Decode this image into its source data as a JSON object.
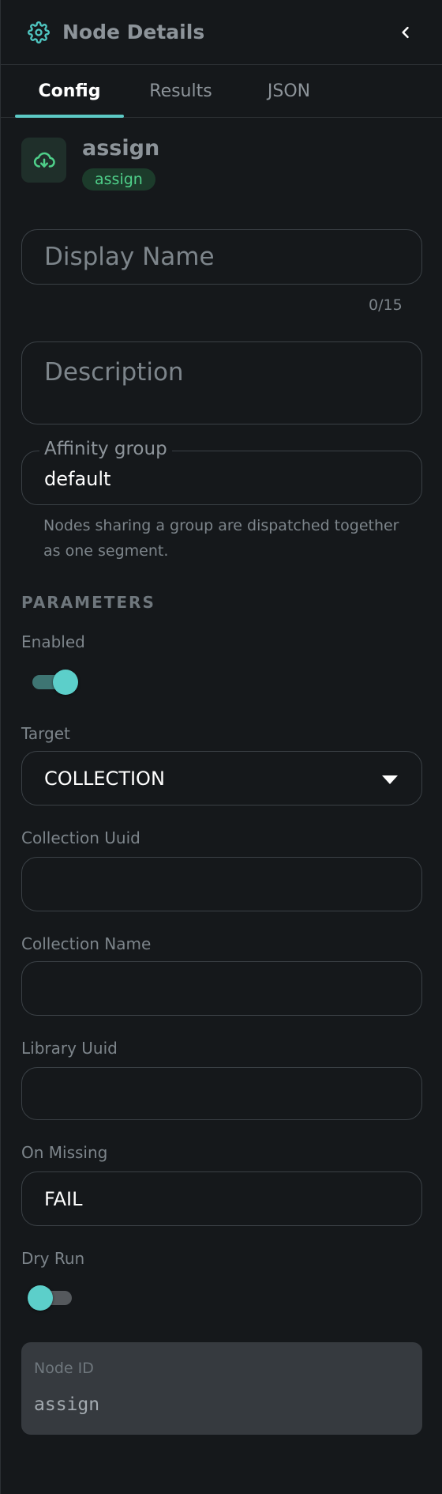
{
  "header": {
    "title": "Node Details",
    "icon": "gear-icon",
    "collapse_icon": "chevron-left-icon"
  },
  "tabs": [
    {
      "label": "Config",
      "active": true
    },
    {
      "label": "Results",
      "active": false
    },
    {
      "label": "JSON",
      "active": false
    }
  ],
  "node": {
    "name": "assign",
    "type_badge": "assign",
    "icon": "cloud-download-icon"
  },
  "display_name": {
    "placeholder": "Display Name",
    "value": "",
    "counter": "0/15"
  },
  "description": {
    "placeholder": "Description",
    "value": ""
  },
  "affinity_group": {
    "label": "Affinity group",
    "value": "default",
    "helper": "Nodes sharing a group are dispatched together as one segment."
  },
  "parameters": {
    "section_title": "PARAMETERS",
    "enabled": {
      "label": "Enabled",
      "on": true
    },
    "target": {
      "label": "Target",
      "value": "COLLECTION"
    },
    "collection_uuid": {
      "label": "Collection Uuid",
      "value": ""
    },
    "collection_name": {
      "label": "Collection Name",
      "value": ""
    },
    "library_uuid": {
      "label": "Library Uuid",
      "value": ""
    },
    "on_missing": {
      "label": "On Missing",
      "value": "FAIL"
    },
    "dry_run": {
      "label": "Dry Run",
      "on": false
    }
  },
  "node_id": {
    "label": "Node ID",
    "value": "assign"
  },
  "colors": {
    "accent": "#5cc9c5",
    "badge_text": "#4fd08a",
    "badge_bg": "#1c3b2b",
    "background": "#15181b"
  }
}
